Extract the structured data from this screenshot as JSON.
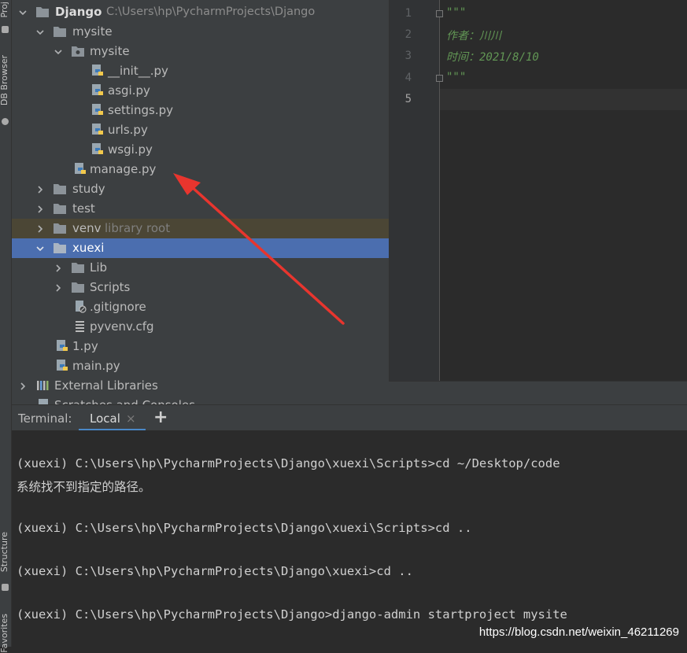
{
  "side_stripe": {
    "project_label": "Proj",
    "db_label": "DB Browser",
    "structure_label": "Structure",
    "favorites_label": "Favorites"
  },
  "project_tree": {
    "root": {
      "name": "Django",
      "path": "C:\\Users\\hp\\PycharmProjects\\Django"
    },
    "items": [
      {
        "label": "mysite"
      },
      {
        "label": "mysite"
      },
      {
        "label": "__init__.py"
      },
      {
        "label": "asgi.py"
      },
      {
        "label": "settings.py"
      },
      {
        "label": "urls.py"
      },
      {
        "label": "wsgi.py"
      },
      {
        "label": "manage.py"
      },
      {
        "label": "study"
      },
      {
        "label": "test"
      },
      {
        "label": "venv",
        "hint": "library root"
      },
      {
        "label": "xuexi"
      },
      {
        "label": "Lib"
      },
      {
        "label": "Scripts"
      },
      {
        "label": ".gitignore"
      },
      {
        "label": "pyvenv.cfg"
      },
      {
        "label": "1.py"
      },
      {
        "label": "main.py"
      },
      {
        "label": "External Libraries"
      },
      {
        "label": "Scratches and Consoles"
      }
    ]
  },
  "editor": {
    "line_numbers": [
      "1",
      "2",
      "3",
      "4",
      "5"
    ],
    "lines": [
      "\"\"\"",
      "作者：川川",
      "时间：2021/8/10",
      "\"\"\"",
      ""
    ]
  },
  "terminal": {
    "title": "Terminal:",
    "tab_label": "Local",
    "close_glyph": "×",
    "add_glyph": "+",
    "lines": [
      "(xuexi) C:\\Users\\hp\\PycharmProjects\\Django\\xuexi\\Scripts>cd ~/Desktop/code",
      "系统找不到指定的路径。",
      "(xuexi) C:\\Users\\hp\\PycharmProjects\\Django\\xuexi\\Scripts>cd ..",
      "(xuexi) C:\\Users\\hp\\PycharmProjects\\Django\\xuexi>cd ..",
      "(xuexi) C:\\Users\\hp\\PycharmProjects\\Django>django-admin startproject mysite"
    ]
  },
  "watermark": "https://blog.csdn.net/weixin_46211269",
  "colors": {
    "selection": "#4b6eaf",
    "library_row": "#4b4635",
    "docstring": "#629755",
    "annotation_arrow": "#e8352e"
  }
}
